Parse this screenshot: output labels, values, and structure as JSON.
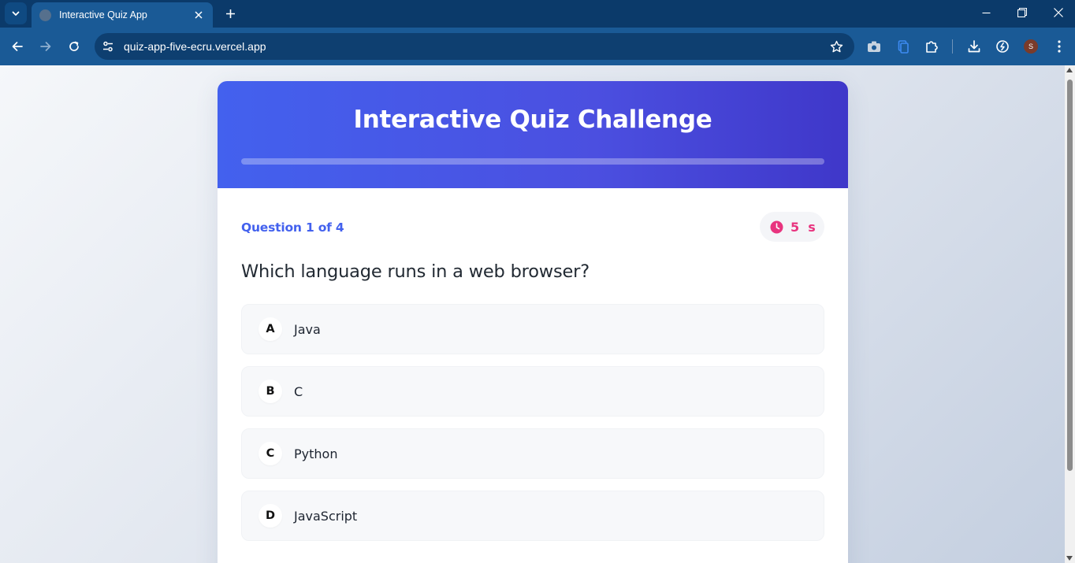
{
  "browser": {
    "tab_title": "Interactive Quiz App",
    "url": "quiz-app-five-ecru.vercel.app",
    "profile_initial": "S"
  },
  "quiz": {
    "title": "Interactive Quiz Challenge",
    "progress_fraction": 0,
    "question_meta": "Question 1 of 4",
    "timer_value": "5  s",
    "question_text": "Which language runs in a web browser?",
    "options": [
      {
        "letter": "A",
        "text": "Java"
      },
      {
        "letter": "B",
        "text": "C"
      },
      {
        "letter": "C",
        "text": "Python"
      },
      {
        "letter": "D",
        "text": "JavaScript"
      }
    ]
  },
  "colors": {
    "accent": "#4361ee",
    "timer": "#e8347f",
    "browser_frame": "#0b3a6a",
    "toolbar": "#1a5a96"
  }
}
